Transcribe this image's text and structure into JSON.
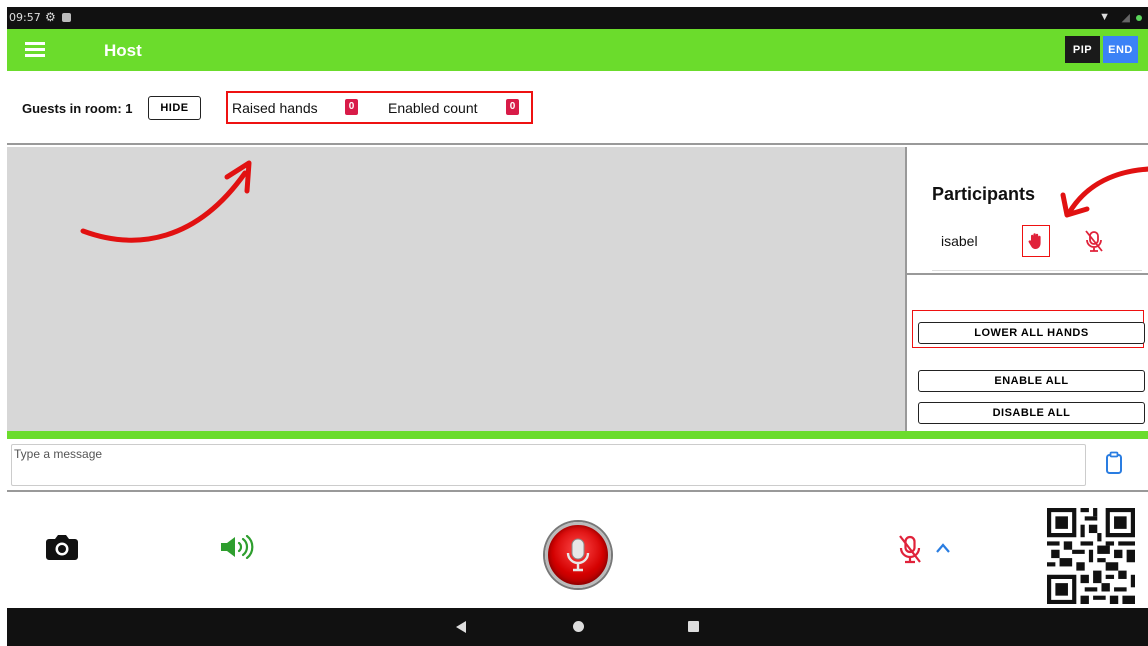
{
  "status_bar": {
    "time": "09:57"
  },
  "app_bar": {
    "title": "Host",
    "pip_label": "PIP",
    "end_label": "END"
  },
  "info_bar": {
    "guests_label": "Guests in room: 1",
    "hide_label": "HIDE",
    "raised_hands_label": "Raised hands",
    "raised_hands_count": "0",
    "enabled_count_label": "Enabled count",
    "enabled_count": "0"
  },
  "participants": {
    "title": "Participants",
    "items": [
      {
        "name": "isabel",
        "hand_raised": true,
        "mic_enabled": false
      }
    ],
    "lower_all_label": "LOWER ALL HANDS",
    "enable_all_label": "ENABLE ALL",
    "disable_all_label": "DISABLE ALL"
  },
  "message": {
    "placeholder": "Type a message"
  },
  "controls": {
    "icons": [
      "camera-icon",
      "speaker-icon",
      "record-mic-icon",
      "mic-off-icon",
      "chevron-up-icon",
      "qr-code"
    ]
  },
  "colors": {
    "app_bar": "#6bdc2c",
    "end_button": "#3b82f6",
    "badge": "#d81b48",
    "annotation": "#e11111",
    "speaker": "#2e9e2e"
  }
}
